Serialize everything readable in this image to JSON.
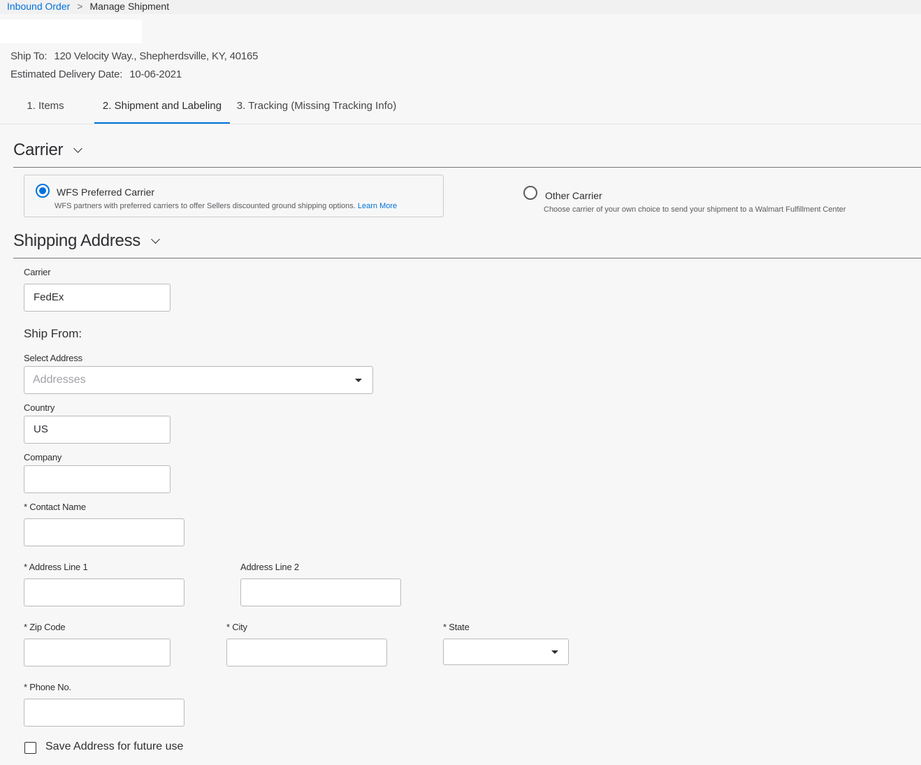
{
  "breadcrumb": {
    "parent": "Inbound Order",
    "separator": ">",
    "current": "Manage Shipment"
  },
  "shipment": {
    "ship_to_label": "Ship To:",
    "ship_to_value": "120 Velocity Way., Shepherdsville, KY, 40165",
    "delivery_label": "Estimated Delivery Date:",
    "delivery_value": "10-06-2021"
  },
  "tabs": [
    {
      "label": "1. Items",
      "active": false
    },
    {
      "label": "2. Shipment and Labeling",
      "active": true
    },
    {
      "label": "3. Tracking (Missing Tracking Info)",
      "active": false
    }
  ],
  "carrier_section": {
    "title": "Carrier",
    "options": [
      {
        "title": "WFS Preferred Carrier",
        "description": "WFS partners with preferred carriers to offer Sellers discounted ground shipping options.",
        "link": "Learn More",
        "selected": true
      },
      {
        "title": "Other Carrier",
        "description": "Choose carrier of your own choice to send your shipment to a Walmart Fulfillment Center",
        "selected": false
      }
    ]
  },
  "shipping_address": {
    "title": "Shipping Address",
    "carrier_label": "Carrier",
    "carrier_value": "FedEx",
    "ship_from_heading": "Ship From:",
    "select_address_label": "Select Address",
    "select_address_placeholder": "Addresses",
    "country_label": "Country",
    "country_value": "US",
    "company_label": "Company",
    "company_value": "",
    "contact_name_label": "* Contact Name",
    "address1_label": "* Address Line 1",
    "address2_label": "Address Line 2",
    "zip_label": "* Zip Code",
    "city_label": "* City",
    "state_label": "* State",
    "phone_label": "* Phone No.",
    "save_address_label": "Save Address for future use",
    "save_address_checked": false
  },
  "colors": {
    "accent": "#0071dc",
    "text": "#2e2f32",
    "background": "#f7f7f7"
  }
}
